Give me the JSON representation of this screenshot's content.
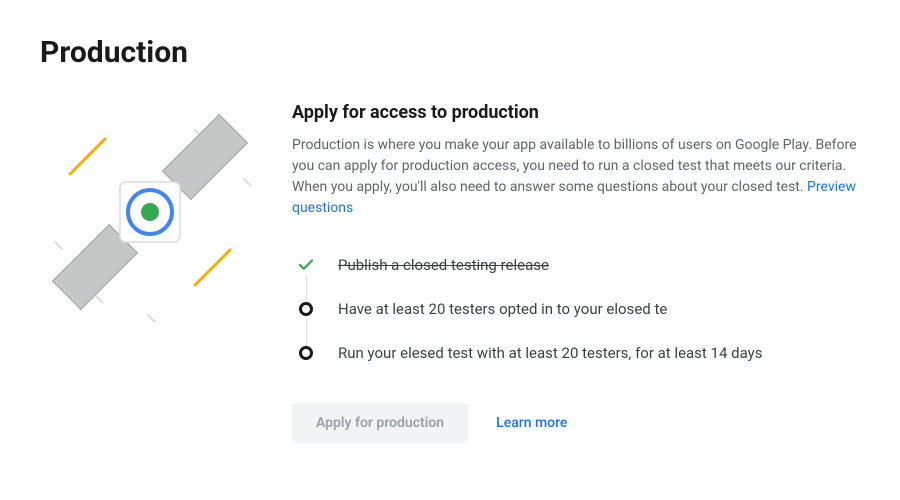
{
  "page_title": "Production",
  "section": {
    "title": "Apply for access to production",
    "description": "Production is where you make your app available to billions of users on Google Play. Before you can apply for production access, you need to run a closed test that meets our criteria. When you apply, you'll also need to answer some questions about your closed test. ",
    "preview_link": "Preview questions"
  },
  "checklist": [
    {
      "text": "Publish a closed testing release",
      "done": true
    },
    {
      "text": "Have at least 20 testers opted in to your elosed te",
      "done": false
    },
    {
      "text": "Run your elesed test with at least 20 testers, for at least 14 days",
      "done": false
    }
  ],
  "actions": {
    "apply_label": "Apply for production",
    "learn_more_label": "Learn more"
  }
}
